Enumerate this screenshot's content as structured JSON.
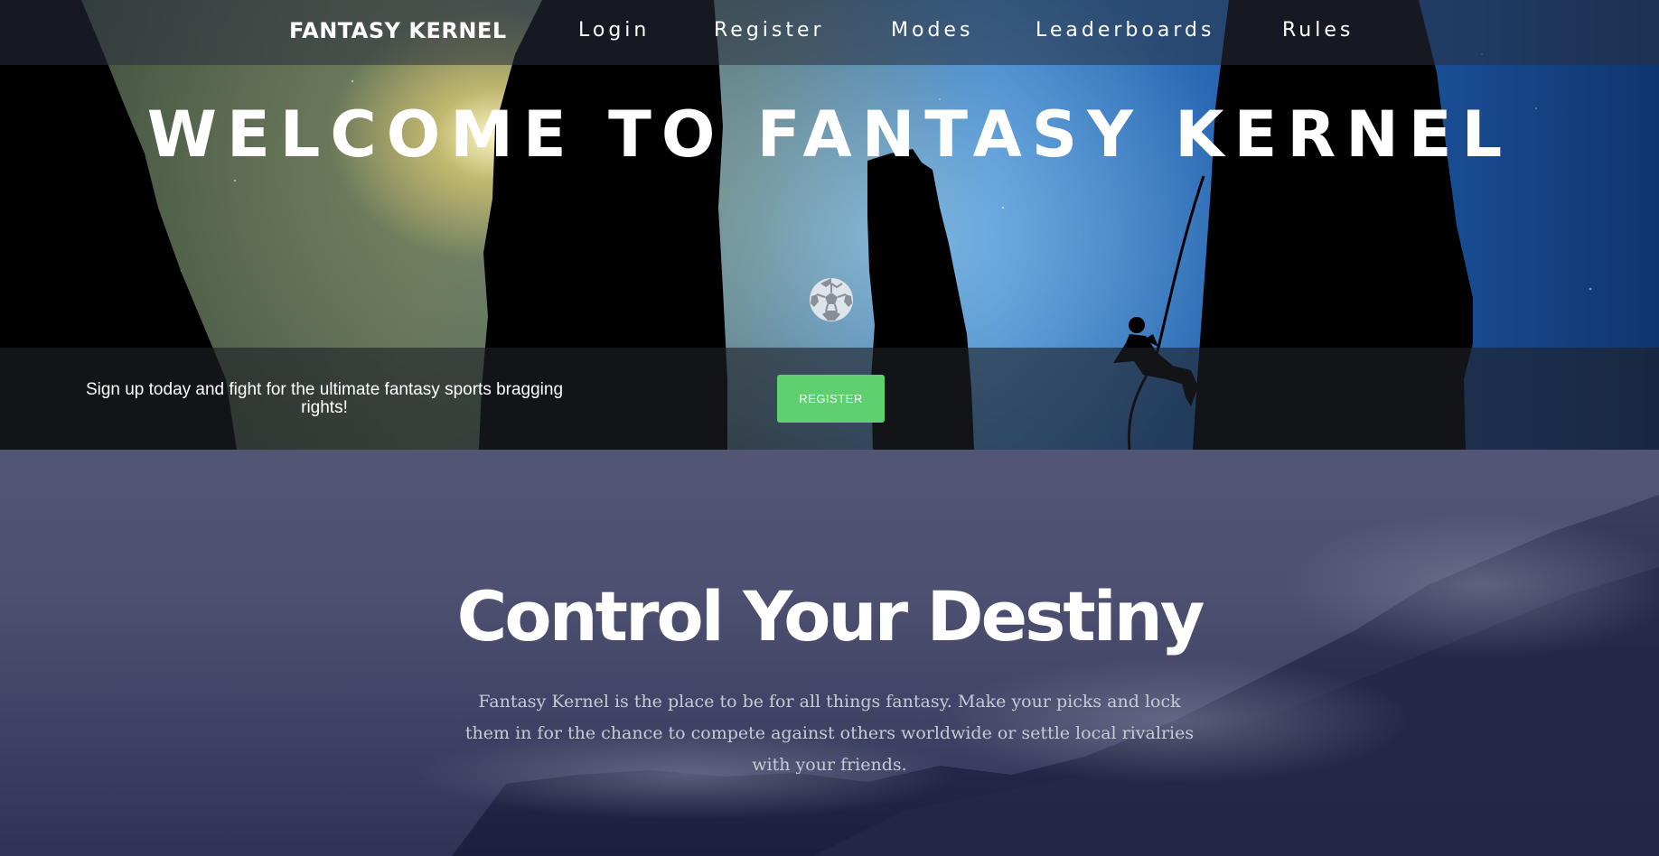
{
  "nav": {
    "brand": "FANTASY KERNEL",
    "links": [
      "Login",
      "Register",
      "Modes",
      "Leaderboards",
      "Rules"
    ]
  },
  "hero": {
    "title": "WELCOME TO FANTASY KERNEL",
    "icon": "soccer-ball-icon",
    "cta_text": "Sign up today and fight for the ultimate fantasy sports bragging rights!",
    "cta_button": "REGISTER"
  },
  "destiny": {
    "title": "Control Your Destiny",
    "body": "Fantasy Kernel is the place to be for all things fantasy. Make your picks and lock them in for the chance to compete against others worldwide or settle local rivalries with your friends."
  },
  "colors": {
    "accent_button": "#5fcf6f",
    "section_bg": "#4d5070",
    "body_text": "#c9cad6"
  }
}
